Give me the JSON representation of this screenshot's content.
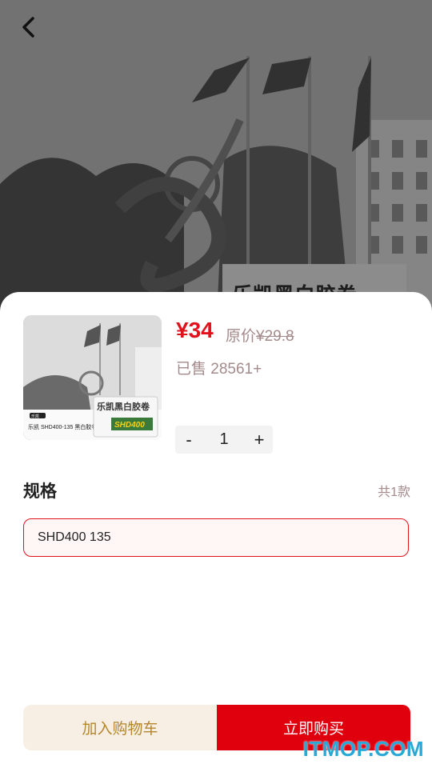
{
  "product": {
    "price": "¥34",
    "original_label": "原价",
    "original_price": "¥29.8",
    "sold": "已售 28561+"
  },
  "quantity": {
    "minus": "-",
    "value": "1",
    "plus": "+"
  },
  "spec": {
    "title": "规格",
    "count": "共1款",
    "options": [
      "SHD400 135"
    ]
  },
  "actions": {
    "add_to_cart": "加入购物车",
    "buy_now": "立即购买"
  },
  "thumb_text": {
    "box_brand": "乐凯黑白胶卷",
    "box_model": "SHD400",
    "tag": "乐凯",
    "caption": "乐凯 SHD400-135 黑白胶卷"
  },
  "background_sign": "乐凯黑白胶卷",
  "watermark": "ITMOP.COM",
  "colors": {
    "accent": "#e0131c",
    "muted": "#a48a8a",
    "cart_bg": "#f7efe4",
    "cart_text": "#b5862d"
  },
  "icons": {
    "back": "chevron-left-icon"
  }
}
